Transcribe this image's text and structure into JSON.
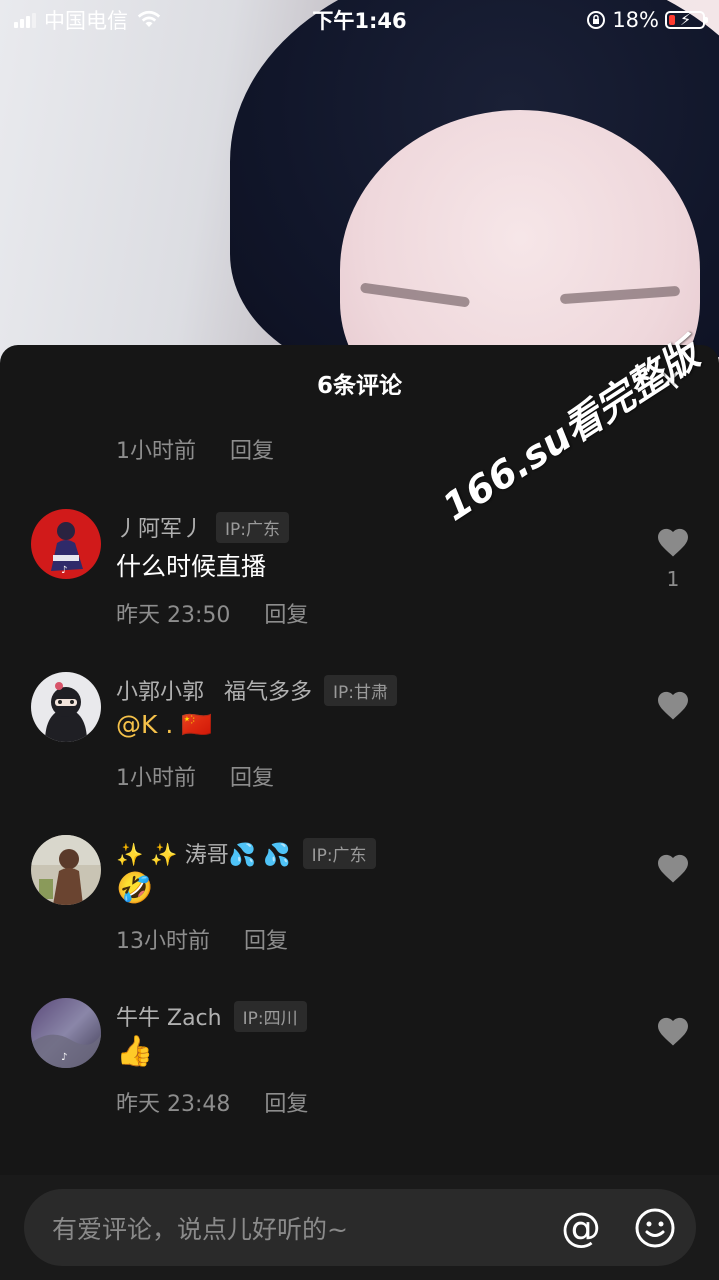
{
  "status_bar": {
    "carrier": "中国电信",
    "time": "下午1:46",
    "battery_percent": "18%",
    "battery_level": 0.18,
    "icons": [
      "signal-icon",
      "wifi-icon",
      "rotation-lock-icon",
      "battery-charging-icon"
    ]
  },
  "sheet": {
    "title": "6条评论",
    "close_label": "✕"
  },
  "orphan_meta": {
    "time": "1小时前",
    "reply": "回复"
  },
  "watermark": "166.su看完整版",
  "comments": [
    {
      "name": "丿阿军丿",
      "ip": "IP:广东",
      "text": "什么时候直播",
      "time": "昨天 23:50",
      "reply": "回复",
      "likes": "1"
    },
    {
      "name": "小郭小郭",
      "extra": "福气多多",
      "ip": "IP:甘肃",
      "text": "@K . 🇨🇳",
      "time": "1小时前",
      "reply": "回复"
    },
    {
      "name": "✨ ✨ 涛哥💦 💦",
      "ip": "IP:广东",
      "text": "🤣",
      "time": "13小时前",
      "reply": "回复"
    },
    {
      "name": "牛牛 Zach",
      "ip": "IP:四川",
      "text": "👍",
      "time": "昨天 23:48",
      "reply": "回复"
    }
  ],
  "input": {
    "placeholder": "有爱评论，说点儿好听的~",
    "at_label": "@"
  },
  "colors": {
    "sheet_bg": "#161616",
    "mention": "#f6c24a",
    "muted": "#8d8d8d"
  }
}
